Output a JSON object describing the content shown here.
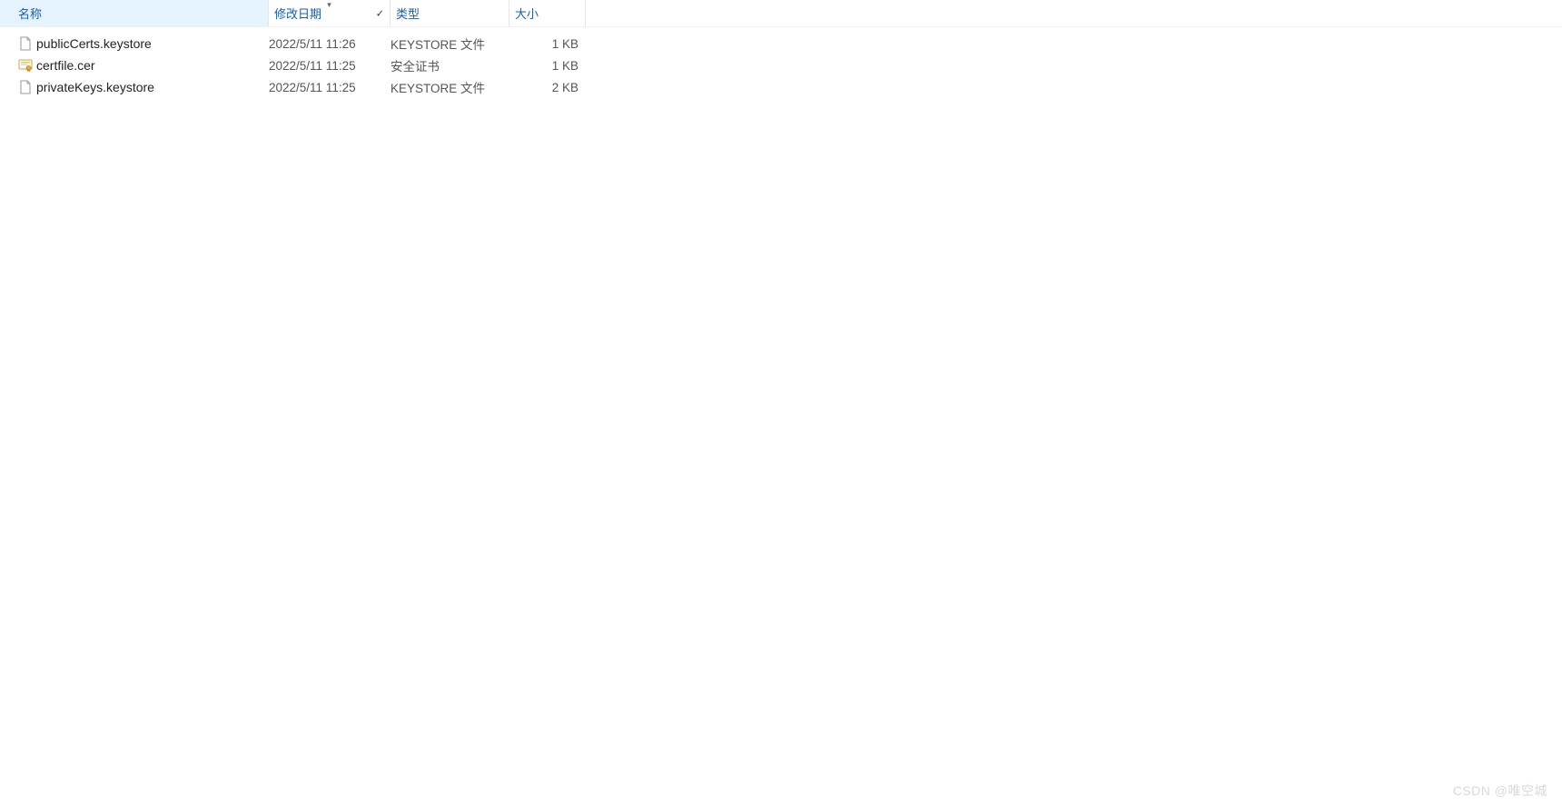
{
  "columns": {
    "name": "名称",
    "date": "修改日期",
    "type": "类型",
    "size": "大小"
  },
  "sort": {
    "column": "date",
    "direction": "desc"
  },
  "files": [
    {
      "icon": "blank-file-icon",
      "name": "publicCerts.keystore",
      "date": "2022/5/11 11:26",
      "type": "KEYSTORE 文件",
      "size": "1 KB"
    },
    {
      "icon": "certificate-icon",
      "name": "certfile.cer",
      "date": "2022/5/11 11:25",
      "type": "安全证书",
      "size": "1 KB"
    },
    {
      "icon": "blank-file-icon",
      "name": "privateKeys.keystore",
      "date": "2022/5/11 11:25",
      "type": "KEYSTORE 文件",
      "size": "2 KB"
    }
  ],
  "watermark": "CSDN @唯空城"
}
